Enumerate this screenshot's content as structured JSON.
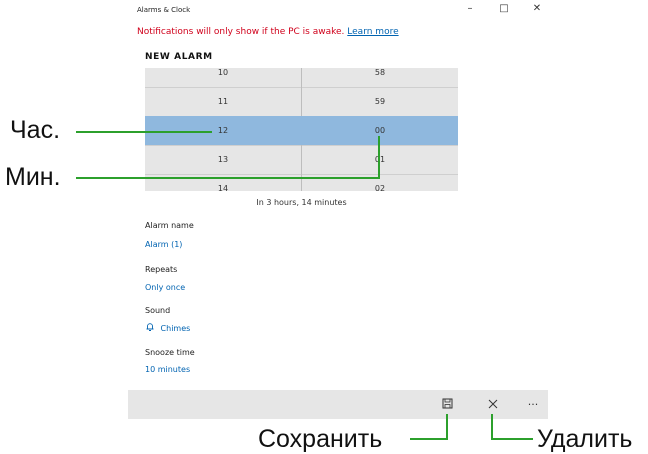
{
  "window": {
    "title": "Alarms & Clock",
    "minimize_icon": "minimize-icon",
    "maximize_icon": "maximize-icon",
    "close_icon": "close-icon"
  },
  "notification": {
    "text": "Notifications will only show if the PC is awake.",
    "link": "Learn more"
  },
  "section_title": "NEW ALARM",
  "time_picker": {
    "rows": [
      {
        "hour": "10",
        "minute": "58"
      },
      {
        "hour": "11",
        "minute": "59"
      },
      {
        "hour": "12",
        "minute": "00",
        "selected": true
      },
      {
        "hour": "13",
        "minute": "01"
      },
      {
        "hour": "14",
        "minute": "02"
      }
    ],
    "selected_color": "#8fb8de"
  },
  "eta": "In 3 hours, 14 minutes",
  "fields": {
    "alarm_name_label": "Alarm name",
    "alarm_name_value": "Alarm (1)",
    "repeats_label": "Repeats",
    "repeats_value": "Only once",
    "sound_label": "Sound",
    "sound_value": "Chimes",
    "sound_icon": "bell-icon",
    "snooze_label": "Snooze time",
    "snooze_value": "10 minutes"
  },
  "app_bar": {
    "save_icon": "save-icon",
    "delete_icon": "close-icon",
    "more_icon": "more-icon",
    "more_glyph": "···"
  },
  "annotations": {
    "hour": "Час.",
    "minute": "Мин.",
    "save": "Сохранить",
    "delete": "Удалить"
  },
  "colors": {
    "accent": "#0063b1",
    "warning": "#d0011b",
    "callout": "#2ca02c"
  }
}
